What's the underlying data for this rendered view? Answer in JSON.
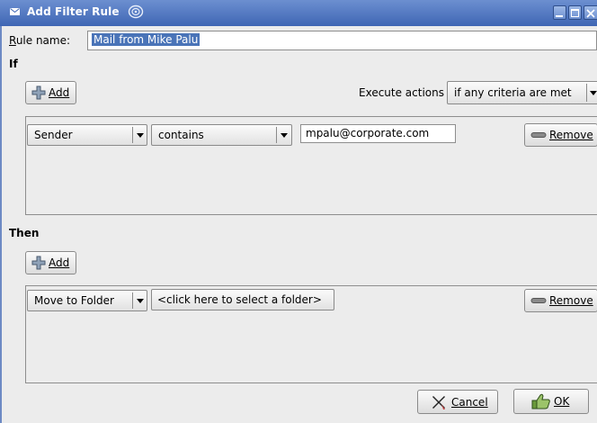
{
  "window": {
    "title": "Add Filter Rule",
    "icon": "mail-envelope-icon",
    "controls": [
      "minimize",
      "maximize",
      "close"
    ]
  },
  "rule_name": {
    "label": "Rule name:",
    "value": "Mail from Mike Palu"
  },
  "if_section": {
    "heading": "If",
    "add_label": "Add",
    "execute_label": "Execute actions",
    "execute_value": "if any criteria are met",
    "criteria": [
      {
        "field": "Sender",
        "operator": "contains",
        "value": "mpalu@corporate.com",
        "remove_label": "Remove"
      }
    ]
  },
  "then_section": {
    "heading": "Then",
    "add_label": "Add",
    "actions": [
      {
        "action": "Move to Folder",
        "target": "<click here to select a folder>",
        "remove_label": "Remove"
      }
    ]
  },
  "footer": {
    "cancel_label": "Cancel",
    "ok_label": "OK"
  },
  "colors": {
    "titlebar": "#3f66b4",
    "selection": "#4a74b8",
    "background": "#ececec"
  }
}
